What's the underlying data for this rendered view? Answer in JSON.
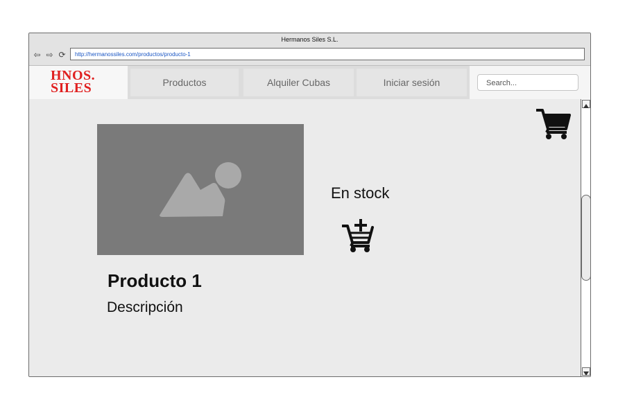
{
  "window": {
    "title": "Hermanos Siles S.L."
  },
  "browser": {
    "url": "http://hermanossiles.com/productos/producto-1"
  },
  "logo": {
    "line1": "HNOS.",
    "line2": "SILES",
    "color": "#e02020"
  },
  "nav": {
    "items": [
      "Productos",
      "Alquiler Cubas",
      "Iniciar sesión"
    ]
  },
  "search": {
    "placeholder": "Search..."
  },
  "product": {
    "title": "Producto 1",
    "description": "Descripción",
    "stock": "En stock"
  },
  "icons": {
    "cart": "shopping-cart-icon",
    "add_to_cart": "cart-plus-icon",
    "image": "image-placeholder-icon"
  }
}
